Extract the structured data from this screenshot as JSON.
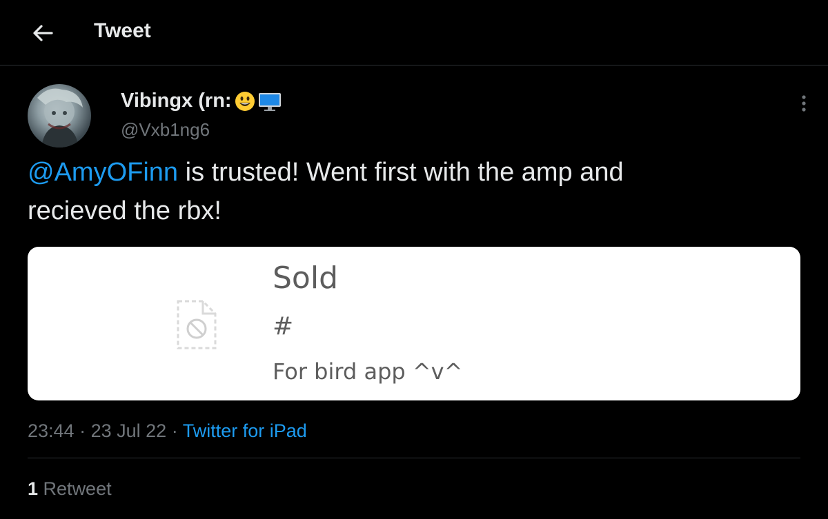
{
  "header": {
    "title": "Tweet",
    "back_icon": "arrow-left-icon"
  },
  "author": {
    "display_name": "Vibingx (rn:",
    "emojis": [
      "grinning-face-icon",
      "desktop-computer-icon"
    ],
    "handle": "@Vxb1ng6"
  },
  "tweet": {
    "mention": "@AmyOFinn",
    "text_line1": " is trusted! Went first with the amp and",
    "text_line2": "recieved the rbx!"
  },
  "card": {
    "title": "Sold",
    "hash": "#",
    "description": "For bird app ^v^",
    "thumb_icon": "broken-image-icon"
  },
  "meta": {
    "time": "23:44",
    "separator": "·",
    "date": "23 Jul 22",
    "source": "Twitter for iPad"
  },
  "stats": {
    "retweet_count": "1",
    "retweet_label": "Retweet"
  },
  "colors": {
    "background": "#000000",
    "text": "#e7e9ea",
    "secondary": "#71767b",
    "link": "#1d9bf0",
    "border": "#2f3336"
  }
}
